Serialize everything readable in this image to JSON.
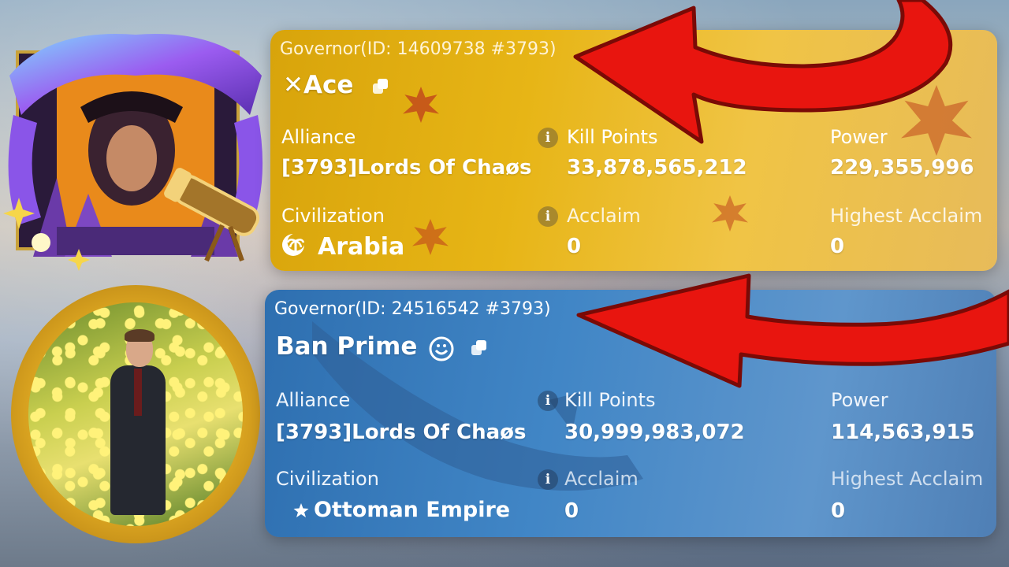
{
  "profile_1": {
    "governor_line": "Governor(ID: 14609738 #3793)",
    "name": "✕Ace",
    "alliance_label": "Alliance",
    "alliance_value": "[3793]Lords Of Chaøs",
    "kill_points_label": "Kill Points",
    "kill_points_value": "33,878,565,212",
    "power_label": "Power",
    "power_value": "229,355,996",
    "civilization_label": "Civilization",
    "civilization_value": "Arabia",
    "acclaim_label": "Acclaim",
    "acclaim_value": "0",
    "highest_acclaim_label": "Highest Acclaim",
    "highest_acclaim_value": "0",
    "civilization_icon": "palm-crescent-icon",
    "accent": "#e0ad14"
  },
  "profile_2": {
    "governor_line": "Governor(ID: 24516542 #3793)",
    "name": "Ban Prime",
    "alliance_label": "Alliance",
    "alliance_value": "[3793]Lords Of Chaøs",
    "kill_points_label": "Kill Points",
    "kill_points_value": "30,999,983,072",
    "power_label": "Power",
    "power_value": "114,563,915",
    "civilization_label": "Civilization",
    "civilization_value": "Ottoman Empire",
    "acclaim_label": "Acclaim",
    "acclaim_value": "0",
    "highest_acclaim_label": "Highest Acclaim",
    "highest_acclaim_value": "0",
    "civilization_icon": "crescent-star-icon",
    "accent": "#3f7fc0"
  },
  "arrow_color": "#e8150f"
}
